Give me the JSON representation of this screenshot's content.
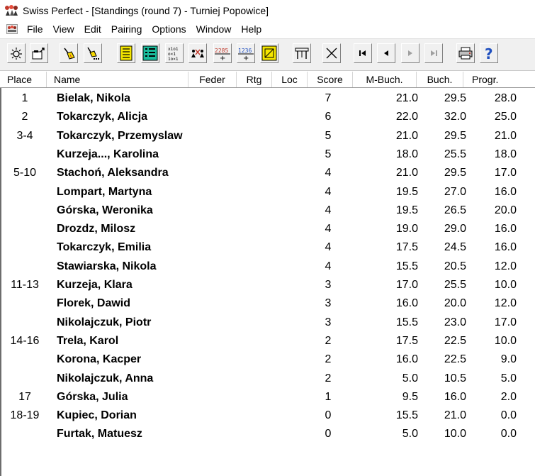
{
  "window": {
    "title": "Swiss Perfect - [Standings  (round 7) - Turniej Popowice]"
  },
  "menu": [
    "File",
    "View",
    "Edit",
    "Pairing",
    "Options",
    "Window",
    "Help"
  ],
  "toolbar": {
    "buttons": [
      {
        "icon": "sun-icon"
      },
      {
        "icon": "open-folder-icon"
      },
      {
        "icon": "broom-icon"
      },
      {
        "icon": "broom-more-icon"
      },
      {
        "icon": "list-yellow-icon"
      },
      {
        "icon": "list-green-icon"
      },
      {
        "icon": "results-grid-icon"
      },
      {
        "icon": "players-swap-icon"
      },
      {
        "icon": "score-plus-icon"
      },
      {
        "icon": "number-plus-icon"
      },
      {
        "icon": "scoresheet-icon"
      },
      {
        "icon": "table-icon"
      },
      {
        "icon": "cross-icon"
      },
      {
        "icon": "first-icon"
      },
      {
        "icon": "prev-icon"
      },
      {
        "icon": "next-icon"
      },
      {
        "icon": "last-icon"
      },
      {
        "icon": "printer-icon"
      },
      {
        "icon": "help-icon"
      }
    ],
    "glyphs": {
      "num1": "2285",
      "num2": "1236",
      "help": "?"
    }
  },
  "columns": [
    "Place",
    "Name",
    "Feder",
    "Rtg",
    "Loc",
    "Score",
    "M-Buch.",
    "Buch.",
    "Progr."
  ],
  "rows": [
    {
      "place": "1",
      "name": "Bielak, Nikola",
      "score": "7",
      "mbuch": "21.0",
      "buch": "29.5",
      "progr": "28.0"
    },
    {
      "place": "2",
      "name": "Tokarczyk, Alicja",
      "score": "6",
      "mbuch": "22.0",
      "buch": "32.0",
      "progr": "25.0"
    },
    {
      "place": "3-4",
      "name": "Tokarczyk, Przemyslaw",
      "score": "5",
      "mbuch": "21.0",
      "buch": "29.5",
      "progr": "21.0"
    },
    {
      "place": "",
      "name": "Kurzeja..., Karolina",
      "score": "5",
      "mbuch": "18.0",
      "buch": "25.5",
      "progr": "18.0"
    },
    {
      "place": "5-10",
      "name": "Stachoń, Aleksandra",
      "score": "4",
      "mbuch": "21.0",
      "buch": "29.5",
      "progr": "17.0"
    },
    {
      "place": "",
      "name": "Lompart, Martyna",
      "score": "4",
      "mbuch": "19.5",
      "buch": "27.0",
      "progr": "16.0"
    },
    {
      "place": "",
      "name": "Górska, Weronika",
      "score": "4",
      "mbuch": "19.5",
      "buch": "26.5",
      "progr": "20.0"
    },
    {
      "place": "",
      "name": "Drozdz, Milosz",
      "score": "4",
      "mbuch": "19.0",
      "buch": "29.0",
      "progr": "16.0"
    },
    {
      "place": "",
      "name": "Tokarczyk, Emilia",
      "score": "4",
      "mbuch": "17.5",
      "buch": "24.5",
      "progr": "16.0"
    },
    {
      "place": "",
      "name": "Stawiarska, Nikola",
      "score": "4",
      "mbuch": "15.5",
      "buch": "20.5",
      "progr": "12.0"
    },
    {
      "place": "11-13",
      "name": "Kurzeja, Klara",
      "score": "3",
      "mbuch": "17.0",
      "buch": "25.5",
      "progr": "10.0"
    },
    {
      "place": "",
      "name": "Florek, Dawid",
      "score": "3",
      "mbuch": "16.0",
      "buch": "20.0",
      "progr": "12.0"
    },
    {
      "place": "",
      "name": "Nikolajczuk, Piotr",
      "score": "3",
      "mbuch": "15.5",
      "buch": "23.0",
      "progr": "17.0"
    },
    {
      "place": "14-16",
      "name": "Trela, Karol",
      "score": "2",
      "mbuch": "17.5",
      "buch": "22.5",
      "progr": "10.0"
    },
    {
      "place": "",
      "name": "Korona, Kacper",
      "score": "2",
      "mbuch": "16.0",
      "buch": "22.5",
      "progr": "9.0"
    },
    {
      "place": "",
      "name": "Nikolajczuk, Anna",
      "score": "2",
      "mbuch": "5.0",
      "buch": "10.5",
      "progr": "5.0"
    },
    {
      "place": "17",
      "name": "Górska, Julia",
      "score": "1",
      "mbuch": "9.5",
      "buch": "16.0",
      "progr": "2.0"
    },
    {
      "place": "18-19",
      "name": "Kupiec, Dorian",
      "score": "0",
      "mbuch": "15.5",
      "buch": "21.0",
      "progr": "0.0"
    },
    {
      "place": "",
      "name": "Furtak, Matuesz",
      "score": "0",
      "mbuch": "5.0",
      "buch": "10.0",
      "progr": "0.0"
    }
  ]
}
